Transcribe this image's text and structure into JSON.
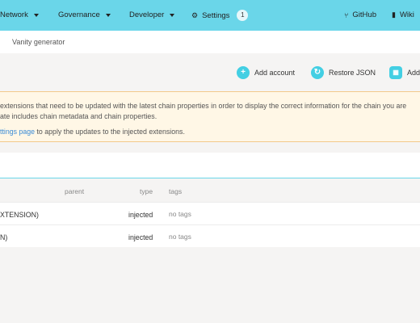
{
  "nav": {
    "network": "Network",
    "governance": "Governance",
    "developer": "Developer",
    "settings": "Settings",
    "settings_count": "1",
    "github": "GitHub",
    "wiki": "Wiki"
  },
  "subnav": {
    "vanity": "Vanity generator"
  },
  "actions": {
    "add_account": "Add account",
    "restore_json": "Restore JSON",
    "add_more": "Add"
  },
  "warning": {
    "line1": "extensions that need to be updated with the latest chain properties in order to display the correct information for the chain you are",
    "line2": "ate includes chain metadata and chain properties.",
    "link": "ttings page",
    "line3_rest": " to apply the updates to the injected extensions."
  },
  "table": {
    "headers": {
      "parent": "parent",
      "type": "type",
      "tags": "tags"
    },
    "rows": [
      {
        "name": "XTENSION)",
        "type": "injected",
        "tags": "no tags"
      },
      {
        "name": "N)",
        "type": "injected",
        "tags": "no tags"
      }
    ]
  }
}
